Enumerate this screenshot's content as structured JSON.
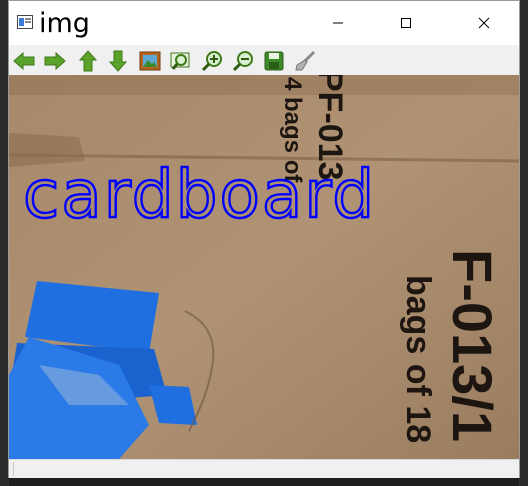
{
  "window": {
    "title": "img",
    "controls": [
      "minimize",
      "maximize",
      "close"
    ]
  },
  "toolbar": {
    "buttons": [
      {
        "id": "back",
        "icon": "arrow-left-icon"
      },
      {
        "id": "forward",
        "icon": "arrow-right-icon"
      },
      {
        "id": "up",
        "icon": "arrow-up-icon"
      },
      {
        "id": "down",
        "icon": "arrow-down-icon"
      },
      {
        "id": "image",
        "icon": "image-icon"
      },
      {
        "id": "zoom-fit",
        "icon": "zoom-fit-icon"
      },
      {
        "id": "zoom-in",
        "icon": "zoom-in-icon"
      },
      {
        "id": "zoom-out",
        "icon": "zoom-out-icon"
      },
      {
        "id": "save",
        "icon": "save-icon"
      },
      {
        "id": "properties",
        "icon": "brush-icon"
      }
    ]
  },
  "image": {
    "label": "cardboard",
    "label_color": "#0000ff",
    "box_text_top_1": "4 bags of",
    "box_text_top_2": "PF-013",
    "box_text_bottom_1": "bags of 18",
    "box_text_bottom_2": "F-013/1",
    "tape_color": "#1f6fe0",
    "cardboard_color": "#a88a6a"
  },
  "status": {
    "text": ""
  }
}
